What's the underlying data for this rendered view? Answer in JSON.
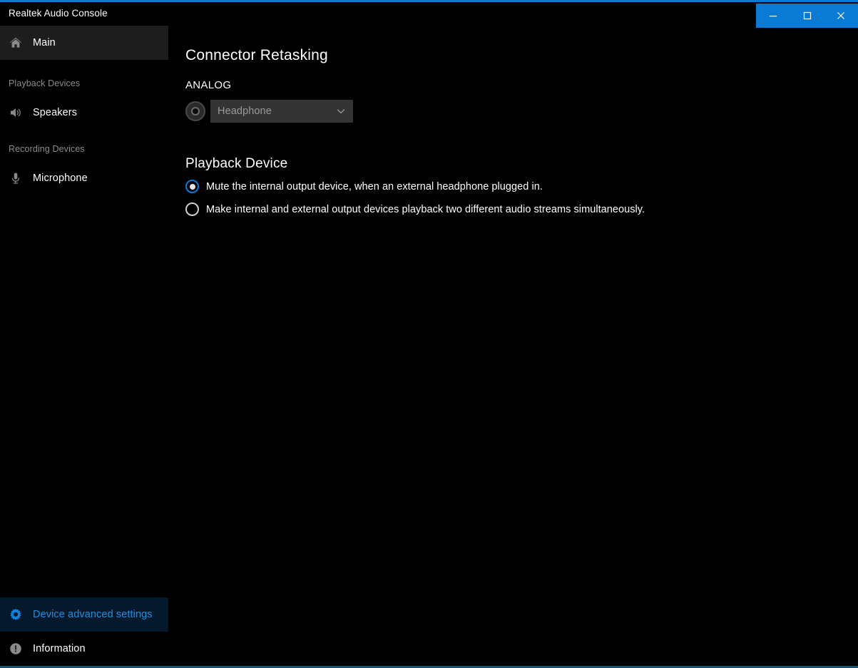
{
  "window": {
    "title": "Realtek Audio Console",
    "controls": [
      {
        "name": "minimize",
        "glyph": "minimize-icon"
      },
      {
        "name": "maximize",
        "glyph": "maximize-icon"
      },
      {
        "name": "close",
        "glyph": "close-icon"
      }
    ],
    "accent_color": "#0a7ad4",
    "background_color": "#000000"
  },
  "sidebar": {
    "main_item": {
      "label": "Main",
      "icon": "home-icon",
      "selected": true
    },
    "groups": [
      {
        "title": "Playback Devices",
        "items": [
          {
            "label": "Speakers",
            "icon": "speaker-icon"
          }
        ]
      },
      {
        "title": "Recording Devices",
        "items": [
          {
            "label": "Microphone",
            "icon": "microphone-icon"
          }
        ]
      }
    ],
    "bottom_items": [
      {
        "label": "Device advanced settings",
        "icon": "gear-icon",
        "highlighted": true,
        "text_color": "#1f8fe0"
      },
      {
        "label": "Information",
        "icon": "info-icon",
        "highlighted": false,
        "text_color": "#ffffff"
      }
    ]
  },
  "main": {
    "connector_retasking": {
      "heading": "Connector Retasking",
      "analog_label": "ANALOG",
      "jack": {
        "icon": "audio-jack-icon",
        "dropdown_value": "Headphone",
        "dropdown_chevron": "chevron-down-icon"
      }
    },
    "playback_device": {
      "heading": "Playback Device",
      "options": [
        {
          "label": "Mute the internal output device, when an external headphone plugged in.",
          "selected": true
        },
        {
          "label": "Make internal and external output devices playback two different audio streams simultaneously.",
          "selected": false
        }
      ]
    }
  }
}
